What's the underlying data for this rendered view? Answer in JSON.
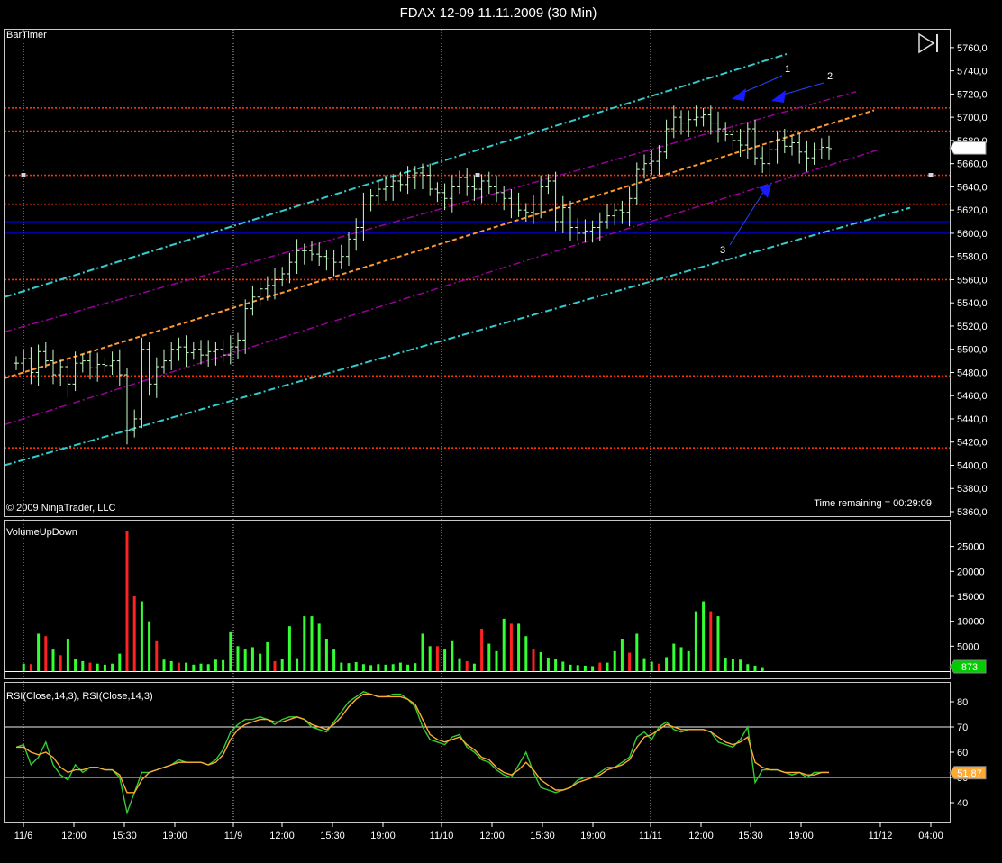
{
  "window": {
    "title": "FDAX 12-09  11.11.2009 (30 Min)",
    "bartimer_label": "BarTimer",
    "copyright": "© 2009 NinjaTrader, LLC",
    "time_remaining": "Time remaining = 00:29:09",
    "play_icon": "play-step-icon"
  },
  "colors": {
    "background": "#000000",
    "bull_bar": "#ccffcc",
    "level": "#ff3300",
    "blue_level": "#0000ff",
    "outer_channel": "#33cccc",
    "inner_channel": "#990099",
    "mid_channel": "#ff9933",
    "vol_up": "#33ff33",
    "vol_down": "#ff2222",
    "rsi_fast": "#33cc33",
    "rsi_slow": "#ffaa33",
    "price_tag": "#ffffff",
    "vol_tag": "#00cc00",
    "rsi_tag": "#ffaa33"
  },
  "x_axis": {
    "labels": [
      "11/6",
      "12:00",
      "15:30",
      "19:00",
      "11/9",
      "12:00",
      "15:30",
      "19:00",
      "11/10",
      "12:00",
      "15:30",
      "19:00",
      "11/11",
      "12:00",
      "15:30",
      "19:00",
      "11/12",
      "04:00"
    ]
  },
  "chart_data": [
    {
      "type": "candlestick",
      "name": "price",
      "ylim": [
        5360,
        5770
      ],
      "y_ticks": [
        "5760,0",
        "5740,0",
        "5720,0",
        "5700,0",
        "5680,0",
        "5660,0",
        "5640,0",
        "5620,0",
        "5600,0",
        "5580,0",
        "5560,0",
        "5540,0",
        "5520,0",
        "5500,0",
        "5480,0",
        "5460,0",
        "5440,0",
        "5420,0",
        "5400,0",
        "5380,0",
        "5360,0"
      ],
      "last_price": "5673,5",
      "horizontal_levels_red": [
        5708,
        5688,
        5650,
        5625,
        5560,
        5477,
        5415
      ],
      "horizontal_levels_blue": [
        5610,
        5600
      ],
      "annotations": [
        "1",
        "2",
        "3"
      ],
      "closes": [
        5488,
        5492,
        5480,
        5498,
        5490,
        5478,
        5485,
        5470,
        5488,
        5490,
        5484,
        5487,
        5486,
        5490,
        5478,
        5430,
        5440,
        5500,
        5470,
        5485,
        5490,
        5500,
        5502,
        5497,
        5500,
        5495,
        5498,
        5500,
        5495,
        5502,
        5508,
        5535,
        5545,
        5552,
        5555,
        5560,
        5565,
        5575,
        5585,
        5585,
        5582,
        5580,
        5578,
        5575,
        5580,
        5595,
        5605,
        5625,
        5632,
        5638,
        5640,
        5645,
        5642,
        5648,
        5652,
        5650,
        5638,
        5635,
        5630,
        5640,
        5648,
        5640,
        5638,
        5645,
        5640,
        5635,
        5630,
        5625,
        5620,
        5618,
        5625,
        5640,
        5645,
        5610,
        5622,
        5605,
        5600,
        5602,
        5605,
        5610,
        5615,
        5620,
        5618,
        5630,
        5655,
        5660,
        5662,
        5670,
        5690,
        5700,
        5695,
        5698,
        5700,
        5702,
        5695,
        5690,
        5685,
        5680,
        5676,
        5690,
        5665,
        5660,
        5672,
        5680,
        5675,
        5678,
        5670,
        5665,
        5672,
        5674,
        5673
      ]
    },
    {
      "type": "bar",
      "name": "VolumeUpDown",
      "ylim": [
        0,
        28000
      ],
      "y_ticks": [
        "25000",
        "20000",
        "15000",
        "10000",
        "5000"
      ],
      "last_value": "873",
      "values": [
        1500,
        1400,
        7500,
        7000,
        4500,
        3200,
        6500,
        2400,
        2000,
        1700,
        1500,
        1300,
        1500,
        3500,
        28000,
        15000,
        14000,
        10000,
        6000,
        2300,
        2000,
        1700,
        1700,
        1300,
        1500,
        1400,
        2300,
        2200,
        7800,
        5000,
        4500,
        4800,
        3500,
        5800,
        2000,
        2400,
        9000,
        2600,
        11000,
        11000,
        9500,
        6500,
        4500,
        1700,
        1600,
        1800,
        1400,
        1200,
        1400,
        1300,
        1400,
        1700,
        1300,
        1600,
        7500,
        5000,
        5000,
        4500,
        6000,
        2600,
        2000,
        1500,
        8500,
        5500,
        4000,
        10500,
        9500,
        9500,
        7000,
        4500,
        3800,
        2700,
        2400,
        1900,
        1300,
        1200,
        1100,
        1000,
        1700,
        1700,
        4000,
        6500,
        3700,
        7500,
        2600,
        1900,
        1500,
        2800,
        5500,
        4800,
        4000,
        12000,
        14000,
        12000,
        11000,
        2700,
        2500,
        2300,
        1400,
        1100,
        800
      ]
    },
    {
      "type": "line",
      "name": "RSI(Close,14,3), RSI(Close,14,3)",
      "ylim": [
        35,
        85
      ],
      "y_ticks": [
        "80",
        "70",
        "60",
        "50",
        "40"
      ],
      "levels": [
        70,
        50
      ],
      "last_value": "51,87",
      "series": [
        {
          "name": "RSI(Close,14,3)",
          "values": [
            62,
            63,
            55,
            58,
            64,
            55,
            51,
            49,
            55,
            52,
            54,
            54,
            53,
            53,
            50,
            36,
            44,
            52,
            52,
            53,
            54,
            55,
            57,
            56,
            56,
            56,
            55,
            57,
            61,
            68,
            71,
            73,
            73,
            74,
            73,
            71,
            73,
            74,
            74,
            73,
            70,
            69,
            68,
            72,
            76,
            80,
            82,
            84,
            83,
            82,
            82,
            83,
            83,
            81,
            78,
            70,
            65,
            64,
            63,
            66,
            67,
            62,
            60,
            57,
            56,
            53,
            51,
            50,
            55,
            60,
            52,
            46,
            45,
            44,
            45,
            46,
            49,
            50,
            50,
            52,
            54,
            54,
            56,
            58,
            66,
            68,
            65,
            70,
            72,
            69,
            68,
            69,
            69,
            69,
            68,
            64,
            63,
            62,
            65,
            70,
            48,
            53,
            53,
            53,
            52,
            51,
            52,
            50,
            52,
            52,
            52
          ]
        },
        {
          "name": "RSI(Close,14,3)",
          "values": [
            62,
            62,
            60,
            59,
            60,
            58,
            54,
            52,
            53,
            53,
            54,
            54,
            53,
            53,
            51,
            44,
            44,
            49,
            52,
            53,
            54,
            55,
            56,
            56,
            56,
            56,
            55,
            56,
            59,
            65,
            69,
            71,
            72,
            73,
            73,
            72,
            72,
            73,
            74,
            73,
            71,
            70,
            69,
            71,
            74,
            78,
            81,
            83,
            83,
            82,
            82,
            82,
            82,
            81,
            79,
            73,
            67,
            65,
            64,
            65,
            66,
            63,
            61,
            58,
            57,
            54,
            52,
            51,
            53,
            56,
            53,
            49,
            47,
            45,
            45,
            46,
            48,
            49,
            50,
            51,
            53,
            54,
            55,
            57,
            62,
            66,
            67,
            69,
            71,
            70,
            69,
            69,
            69,
            69,
            68,
            66,
            64,
            63,
            64,
            66,
            56,
            54,
            53,
            53,
            52,
            52,
            52,
            51,
            51,
            52,
            52
          ]
        }
      ]
    }
  ]
}
